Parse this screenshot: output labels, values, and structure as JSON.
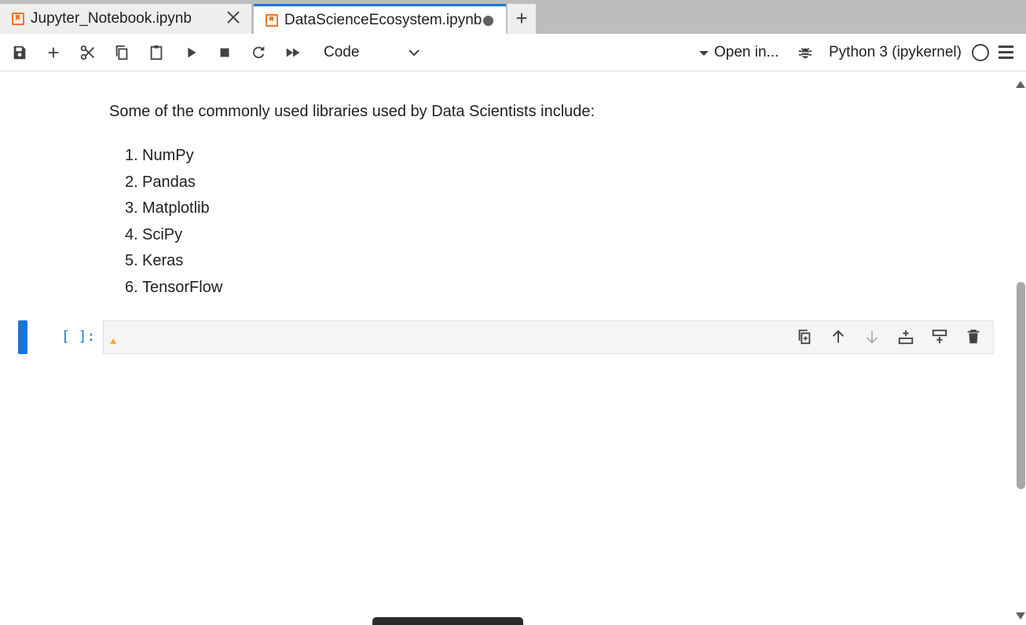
{
  "tabs": [
    {
      "label": "Jupyter_Notebook.ipynb",
      "active": false,
      "state": "close"
    },
    {
      "label": "DataScienceEcosystem.ipynb",
      "active": true,
      "state": "unsaved"
    }
  ],
  "new_tab_label": "+",
  "toolbar": {
    "icons": [
      "save-icon",
      "add-cell-icon",
      "cut-icon",
      "copy-icon",
      "paste-icon",
      "run-icon",
      "stop-icon",
      "restart-icon",
      "fast-forward-icon"
    ],
    "cell_type": "Code",
    "open_in": "Open in...",
    "kernel": "Python 3 (ipykernel)"
  },
  "markdown": {
    "intro": "Some of the commonly used libraries used by Data Scientists include:",
    "libraries": [
      {
        "num": "1.",
        "name": "NumPy"
      },
      {
        "num": "2.",
        "name": "Pandas"
      },
      {
        "num": "3.",
        "name": "Matplotlib"
      },
      {
        "num": "4.",
        "name": "SciPy"
      },
      {
        "num": "5.",
        "name": "Keras"
      },
      {
        "num": "6.",
        "name": "TensorFlow"
      }
    ]
  },
  "code_cell": {
    "prompt": "[ ]:",
    "value": "",
    "tools": [
      "duplicate-cell-icon",
      "move-up-icon",
      "move-down-icon",
      "insert-above-icon",
      "insert-below-icon",
      "delete-cell-icon"
    ]
  },
  "colors": {
    "accent": "#1976d2",
    "tab_icon": "#f37626",
    "tab_bar": "#bdbdbd"
  }
}
